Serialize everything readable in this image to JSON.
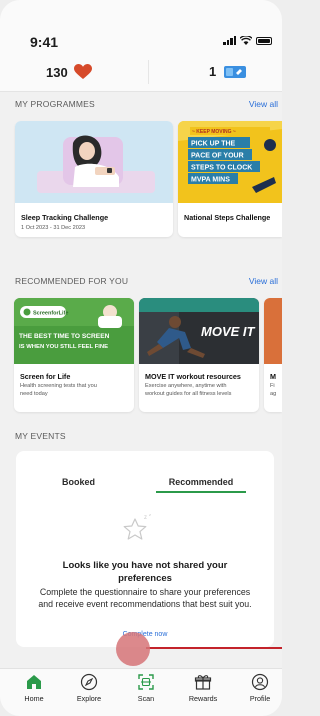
{
  "status": {
    "time": "9:41"
  },
  "header": {
    "hearts_count": "130",
    "tickets_count": "1"
  },
  "programmes": {
    "title": "MY PROGRAMMES",
    "view_all": "View all",
    "items": [
      {
        "title": "Sleep Tracking Challenge",
        "dates": "1 Oct 2023 - 31 Dec 2023"
      },
      {
        "title": "National Steps Challenge",
        "banner_text": [
          "~ KEEP MOVING ~",
          "PICK UP THE",
          "PACE OF YOUR",
          "STEPS TO CLOCK",
          "MVPA MINS"
        ]
      }
    ]
  },
  "recommended": {
    "title": "RECOMMENDED FOR YOU",
    "view_all": "View all",
    "items": [
      {
        "title": "Screen for Life",
        "desc_line1": "Health screening tests that you",
        "desc_line2": "need today",
        "tag": "ScreenforLife",
        "banner_line1": "THE BEST TIME TO SCREEN",
        "banner_line2": "IS WHEN YOU STILL FEEL FINE"
      },
      {
        "title": "MOVE IT workout resources",
        "desc_line1": "Exercise anywhere, anytime with",
        "desc_line2": "workout guides for all fitness levels",
        "banner_text": "MOVE IT"
      },
      {
        "title": "M",
        "desc_line1": "Fi",
        "desc_line2": "ag"
      }
    ]
  },
  "events": {
    "title": "MY EVENTS",
    "tabs": [
      "Booked",
      "Recommended"
    ],
    "active_tab": "Recommended",
    "empty_title_line1": "Looks like you have not shared your",
    "empty_title_line2": "preferences",
    "empty_desc": "Complete the questionnaire to share your preferences and receive event recommendations that best suit you.",
    "link": "Complete now"
  },
  "tabbar": {
    "items": [
      {
        "label": "Home",
        "icon": "home-icon",
        "active": true
      },
      {
        "label": "Explore",
        "icon": "compass-icon"
      },
      {
        "label": "Scan",
        "icon": "scan-icon"
      },
      {
        "label": "Rewards",
        "icon": "gift-icon"
      },
      {
        "label": "Profile",
        "icon": "profile-icon"
      }
    ]
  },
  "colors": {
    "accent_blue": "#2a6fd8",
    "accent_green": "#2b9a4a",
    "heart_red": "#d64a2a",
    "ticket_blue": "#3a8fe0"
  }
}
